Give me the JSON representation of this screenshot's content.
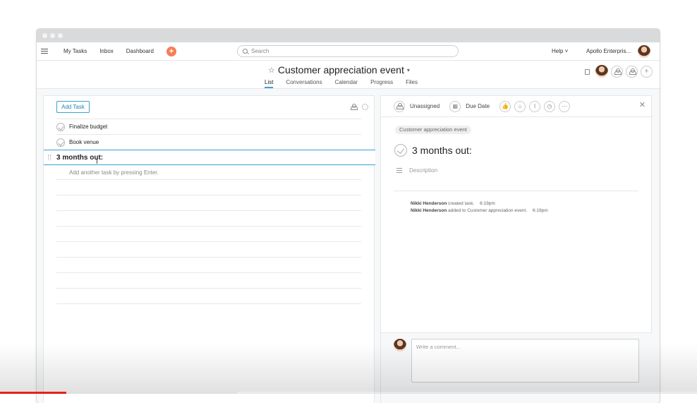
{
  "topbar": {
    "nav": [
      "My Tasks",
      "Inbox",
      "Dashboard"
    ],
    "add_label": "+",
    "search_placeholder": "Search",
    "help_label": "Help ˅",
    "org_label": "Apollo Enterpris..."
  },
  "project": {
    "title": "Customer appreciation event",
    "tabs": [
      "List",
      "Conversations",
      "Calendar",
      "Progress",
      "Files"
    ],
    "active_tab": "List",
    "member_add": "+"
  },
  "task_list": {
    "add_task_label": "Add Task",
    "tasks": [
      "Finalize budget",
      "Book venue"
    ],
    "section": "3 months out:",
    "hint": "Add another task by pressing Enter."
  },
  "detail": {
    "assignee": "Unassigned",
    "due_date": "Due Date",
    "close_glyph": "✕",
    "more_glyph": "⋯",
    "project_tag": "Customer appreciation event",
    "title": "3 months out:",
    "description_placeholder": "Description",
    "stories": [
      {
        "user": "Nikki Henderson",
        "text": "created task.",
        "time": "6:19pm"
      },
      {
        "user": "Nikki Henderson",
        "text": "added to Customer appreciation event.",
        "time": "6:19pm"
      }
    ],
    "comment_placeholder": "Write a comment..."
  },
  "video": {
    "progress": 0.095,
    "buffered_to": 0.34
  },
  "colors": {
    "accent": "#3aa0d6",
    "add_button": "#f77d55",
    "progress": "#e62117"
  }
}
